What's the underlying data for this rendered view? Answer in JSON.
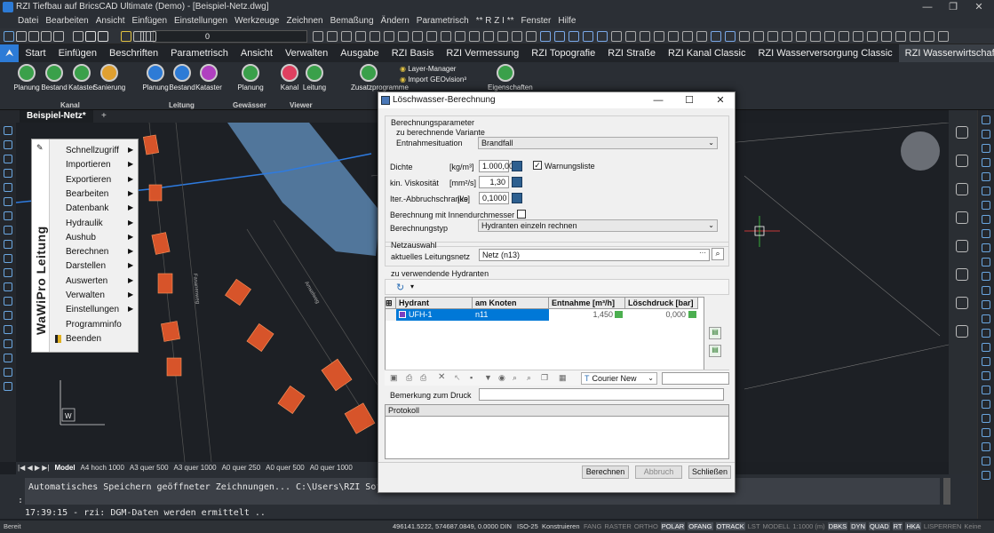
{
  "window": {
    "title": "RZI Tiefbau auf BricsCAD Ultimate (Demo) - [Beispiel-Netz.dwg]",
    "minimize": "—",
    "restore": "❐",
    "close": "✕"
  },
  "menu": [
    "Datei",
    "Bearbeiten",
    "Ansicht",
    "Einfügen",
    "Einstellungen",
    "Werkzeuge",
    "Zeichnen",
    "Bemaßung",
    "Ändern",
    "Parametrisch",
    "** R Z I **",
    "Fenster",
    "Hilfe"
  ],
  "toolbar": {
    "layer_value": "0"
  },
  "ribbon_tabs": [
    "Start",
    "Einfügen",
    "Beschriften",
    "Parametrisch",
    "Ansicht",
    "Verwalten",
    "Ausgabe",
    "RZI Basis",
    "RZI Vermessung",
    "RZI Topografie",
    "RZI Straße",
    "RZI Kanal Classic",
    "RZI Wasserversorgung Classic",
    "RZI Wasserwirtschaft Pro"
  ],
  "ribbon_active_tab": "RZI Wasserwirtschaft Pro",
  "ribbon": {
    "kanal": {
      "group": "Kanal",
      "buttons": [
        "Planung",
        "Bestand",
        "Kataster",
        "Sanierung"
      ]
    },
    "leitung": {
      "group": "Leitung",
      "buttons": [
        "Planung",
        "Bestand",
        "Kataster"
      ]
    },
    "gewaesser": {
      "group": "Gewässer",
      "buttons": [
        "Planung"
      ]
    },
    "viewer": {
      "group": "Viewer",
      "buttons": [
        "Kanal",
        "Leitung"
      ]
    },
    "extra": {
      "zusatz": "Zusatzprogramme",
      "layer_manager": "Layer-Manager",
      "import": "Import GEOvision³",
      "eigenschaften": "Eigenschaften"
    }
  },
  "doc_tab": {
    "name": "Beispiel-Netz*",
    "add": "+"
  },
  "context_menu": {
    "title": "WaWiPro Leitung",
    "items": [
      {
        "label": "Schnellzugriff",
        "submenu": true
      },
      {
        "label": "Importieren",
        "submenu": true
      },
      {
        "label": "Exportieren",
        "submenu": true
      },
      {
        "label": "Bearbeiten",
        "submenu": true
      },
      {
        "label": "Datenbank",
        "submenu": true
      },
      {
        "label": "Hydraulik",
        "submenu": true
      },
      {
        "label": "Aushub",
        "submenu": true
      },
      {
        "label": "Berechnen",
        "submenu": true
      },
      {
        "label": "Darstellen",
        "submenu": true
      },
      {
        "label": "Auswerten",
        "submenu": true
      },
      {
        "label": "Verwalten",
        "submenu": true
      },
      {
        "label": "Einstellungen",
        "submenu": true
      },
      {
        "label": "Programminfo",
        "submenu": false
      },
      {
        "label": "Beenden",
        "submenu": false
      }
    ]
  },
  "layout_tabs": [
    "Model",
    "A4 hoch 1000",
    "A3 quer 500",
    "A3 quer 1000",
    "A0 quer 250",
    "A0 quer 500",
    "A0 quer 1000"
  ],
  "command": {
    "history": "Automatisches Speichern geöffneter Zeichnungen... C:\\Users\\RZI Software\\App",
    "prompt": ":",
    "line": "17:39:15 - rzi: DGM-Daten werden ermittelt .."
  },
  "status": {
    "ready": "Bereit",
    "coords": "496141.5222, 574687.0849, 0.0000",
    "din": "DIN",
    "iso": "ISO-25",
    "mode": "Konstruieren",
    "toggles": [
      {
        "label": "FANG",
        "on": false
      },
      {
        "label": "RASTER",
        "on": false
      },
      {
        "label": "ORTHO",
        "on": false
      },
      {
        "label": "POLAR",
        "on": true
      },
      {
        "label": "OFANG",
        "on": true
      },
      {
        "label": "OTRACK",
        "on": true
      },
      {
        "label": "LST",
        "on": false
      },
      {
        "label": "MODELL",
        "on": false
      },
      {
        "label": "1:1000 (m)",
        "on": false
      },
      {
        "label": "DBKS",
        "on": true
      },
      {
        "label": "DYN",
        "on": true
      },
      {
        "label": "QUAD",
        "on": true
      },
      {
        "label": "RT",
        "on": true
      },
      {
        "label": "HKA",
        "on": true
      },
      {
        "label": "LISPERREN",
        "on": false
      },
      {
        "label": "Keine",
        "on": false
      }
    ]
  },
  "canvas_labels": {
    "street1": "Fasanenweg",
    "street2": "Amselweg"
  },
  "dialog": {
    "title": "Löschwasser-Berechnung",
    "section_params": "Berechnungsparameter",
    "sub_variant": "zu berechnende Variante",
    "entnahme_label": "Entnahmesituation",
    "entnahme_value": "Brandfall",
    "dichte_label": "Dichte",
    "dichte_unit": "[kg/m³]",
    "dichte_value": "1.000,00",
    "visk_label": "kin. Viskosität",
    "visk_unit": "[mm²/s]",
    "visk_value": "1,30",
    "iter_label": "Iter.-Abbruchschranke",
    "iter_unit": "[l/s]",
    "iter_value": "0,1000",
    "warnungsliste": "Warnungsliste",
    "innendurch": "Berechnung mit Innendurchmesser",
    "typ_label": "Berechnungstyp",
    "typ_value": "Hydranten einzeln rechnen",
    "section_netz": "Netzauswahl",
    "netz_label": "aktuelles  Leitungsnetz",
    "netz_value": "Netz (n13)",
    "hydranten_label": "zu verwendende Hydranten",
    "table_headers": [
      "Hydrant",
      "am Knoten",
      "Entnahme [m³/h]",
      "Löschdruck [bar]"
    ],
    "rows": [
      {
        "hydrant": "UFH-1",
        "knoten": "n11",
        "entnahme": "1,450",
        "druck": "0,000"
      }
    ],
    "font_value": "Courier New",
    "bemerkung_label": "Bemerkung zum Druck",
    "protokoll": "Protokoll",
    "btn_berechnen": "Berechnen",
    "btn_abbruch": "Abbruch",
    "btn_schliessen": "Schließen"
  },
  "colors": {
    "accent": "#2d7bd6",
    "selection": "#0078d7",
    "house": "#d7542a",
    "water": "#5b86b0"
  }
}
